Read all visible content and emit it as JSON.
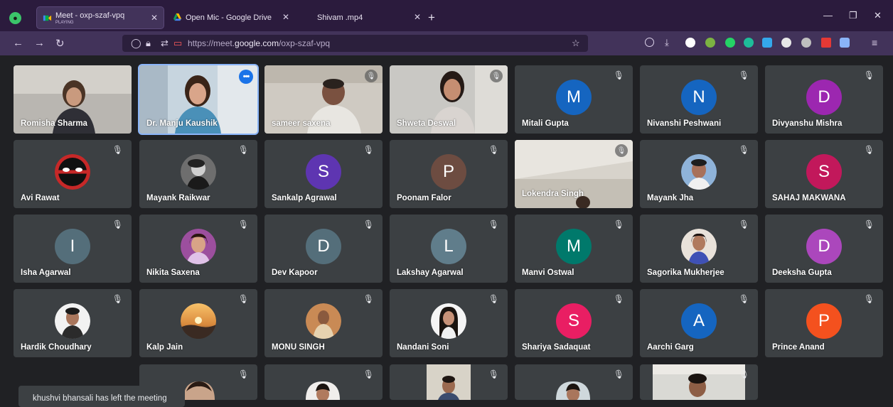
{
  "browser": {
    "tabs": [
      {
        "title": "Meet - oxp-szaf-vpq",
        "subtitle": "PLAYING"
      },
      {
        "title": "Open Mic - Google Drive"
      },
      {
        "title": "Shivam .mp4"
      }
    ],
    "url_prefix": "https://meet.",
    "url_domain": "google.com",
    "url_path": "/oxp-szaf-vpq"
  },
  "participants": [
    {
      "name": "Romisha Sharma",
      "kind": "video"
    },
    {
      "name": "Dr. Manju Kaushik",
      "kind": "video"
    },
    {
      "name": "sameer saxena",
      "kind": "video"
    },
    {
      "name": "Shweta Deswal",
      "kind": "video"
    },
    {
      "name": "Mitali Gupta",
      "initial": "M",
      "color": "#1565c0"
    },
    {
      "name": "Nivanshi Peshwani",
      "initial": "N",
      "color": "#1565c0"
    },
    {
      "name": "Divyanshu Mishra",
      "initial": "D",
      "color": "#9c27b0"
    },
    {
      "name": "Avi Rawat",
      "kind": "photo"
    },
    {
      "name": "Mayank Raikwar",
      "kind": "photo"
    },
    {
      "name": "Sankalp Agrawal",
      "initial": "S",
      "color": "#5e35b1"
    },
    {
      "name": "Poonam Falor",
      "initial": "P",
      "color": "#6d4c41"
    },
    {
      "name": "Lokendra Singh",
      "kind": "video"
    },
    {
      "name": "Mayank Jha",
      "kind": "photo"
    },
    {
      "name": "SAHAJ MAKWANA",
      "initial": "S",
      "color": "#c2185b"
    },
    {
      "name": "Isha Agarwal",
      "initial": "I",
      "color": "#546e7a"
    },
    {
      "name": "Nikita Saxena",
      "kind": "photo"
    },
    {
      "name": "Dev Kapoor",
      "initial": "D",
      "color": "#546e7a"
    },
    {
      "name": "Lakshay Agarwal",
      "initial": "L",
      "color": "#607d8b"
    },
    {
      "name": "Manvi Ostwal",
      "initial": "M",
      "color": "#00796b"
    },
    {
      "name": "Sagorika Mukherjee",
      "kind": "photo"
    },
    {
      "name": "Deeksha Gupta",
      "initial": "D",
      "color": "#ab47bc"
    },
    {
      "name": "Hardik Choudhary",
      "kind": "photo"
    },
    {
      "name": "Kalp Jain",
      "kind": "photo"
    },
    {
      "name": "MONU SINGH",
      "kind": "photo"
    },
    {
      "name": "Nandani Soni",
      "kind": "photo"
    },
    {
      "name": "Shariya Sadaquat",
      "initial": "S",
      "color": "#e91e63"
    },
    {
      "name": "Aarchi Garg",
      "initial": "A",
      "color": "#1565c0"
    },
    {
      "name": "Prince Anand",
      "initial": "P",
      "color": "#f4511e"
    }
  ],
  "notification": "khushvi bhansali has left the meeting",
  "colors": {
    "accent": "#1a73e8",
    "tile": "#3c4043",
    "background": "#202124"
  }
}
